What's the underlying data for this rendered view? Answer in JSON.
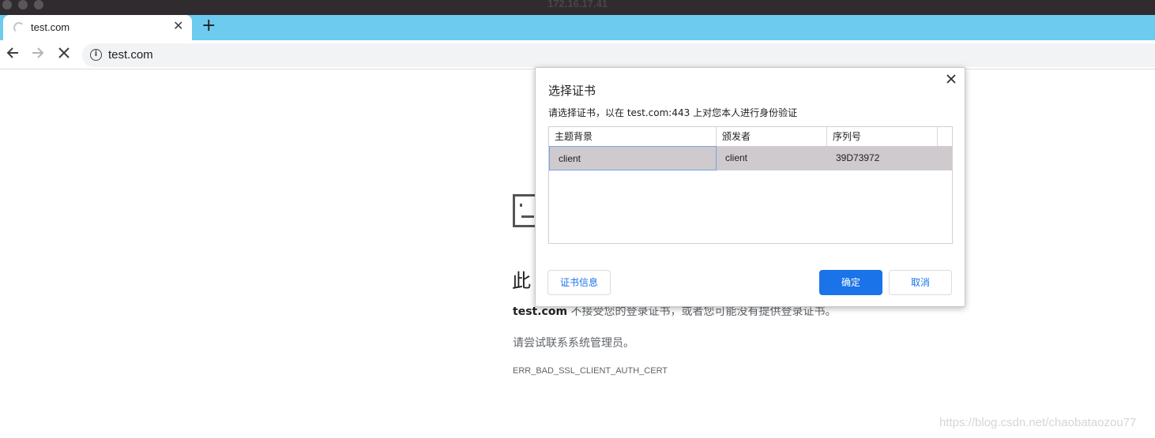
{
  "window": {
    "title": "172.16.17.41"
  },
  "tab": {
    "title": "test.com",
    "close_symbol": "✕",
    "new_tab_symbol": "+"
  },
  "toolbar": {
    "url": "test.com"
  },
  "error_page": {
    "heading": "此",
    "domain": "test.com",
    "line1_rest": " 不接受您的登录证书，或者您可能没有提供登录证书。",
    "line2": "请尝试联系系统管理员。",
    "code": "ERR_BAD_SSL_CLIENT_AUTH_CERT"
  },
  "dialog": {
    "title": "选择证书",
    "subtitle": "请选择证书，以在 test.com:443 上对您本人进行身份验证",
    "columns": [
      "主题背景",
      "颁发者",
      "序列号"
    ],
    "rows": [
      {
        "subject": "client",
        "issuer": "client",
        "serial": "39D73972"
      }
    ],
    "cert_info_button": "证书信息",
    "ok_button": "确定",
    "cancel_button": "取消"
  },
  "watermark": "https://blog.csdn.net/chaobataozou77",
  "colors": {
    "tabstrip": "#6ccbee",
    "accent": "#1a73e8",
    "selected_row": "#cfcacd"
  }
}
